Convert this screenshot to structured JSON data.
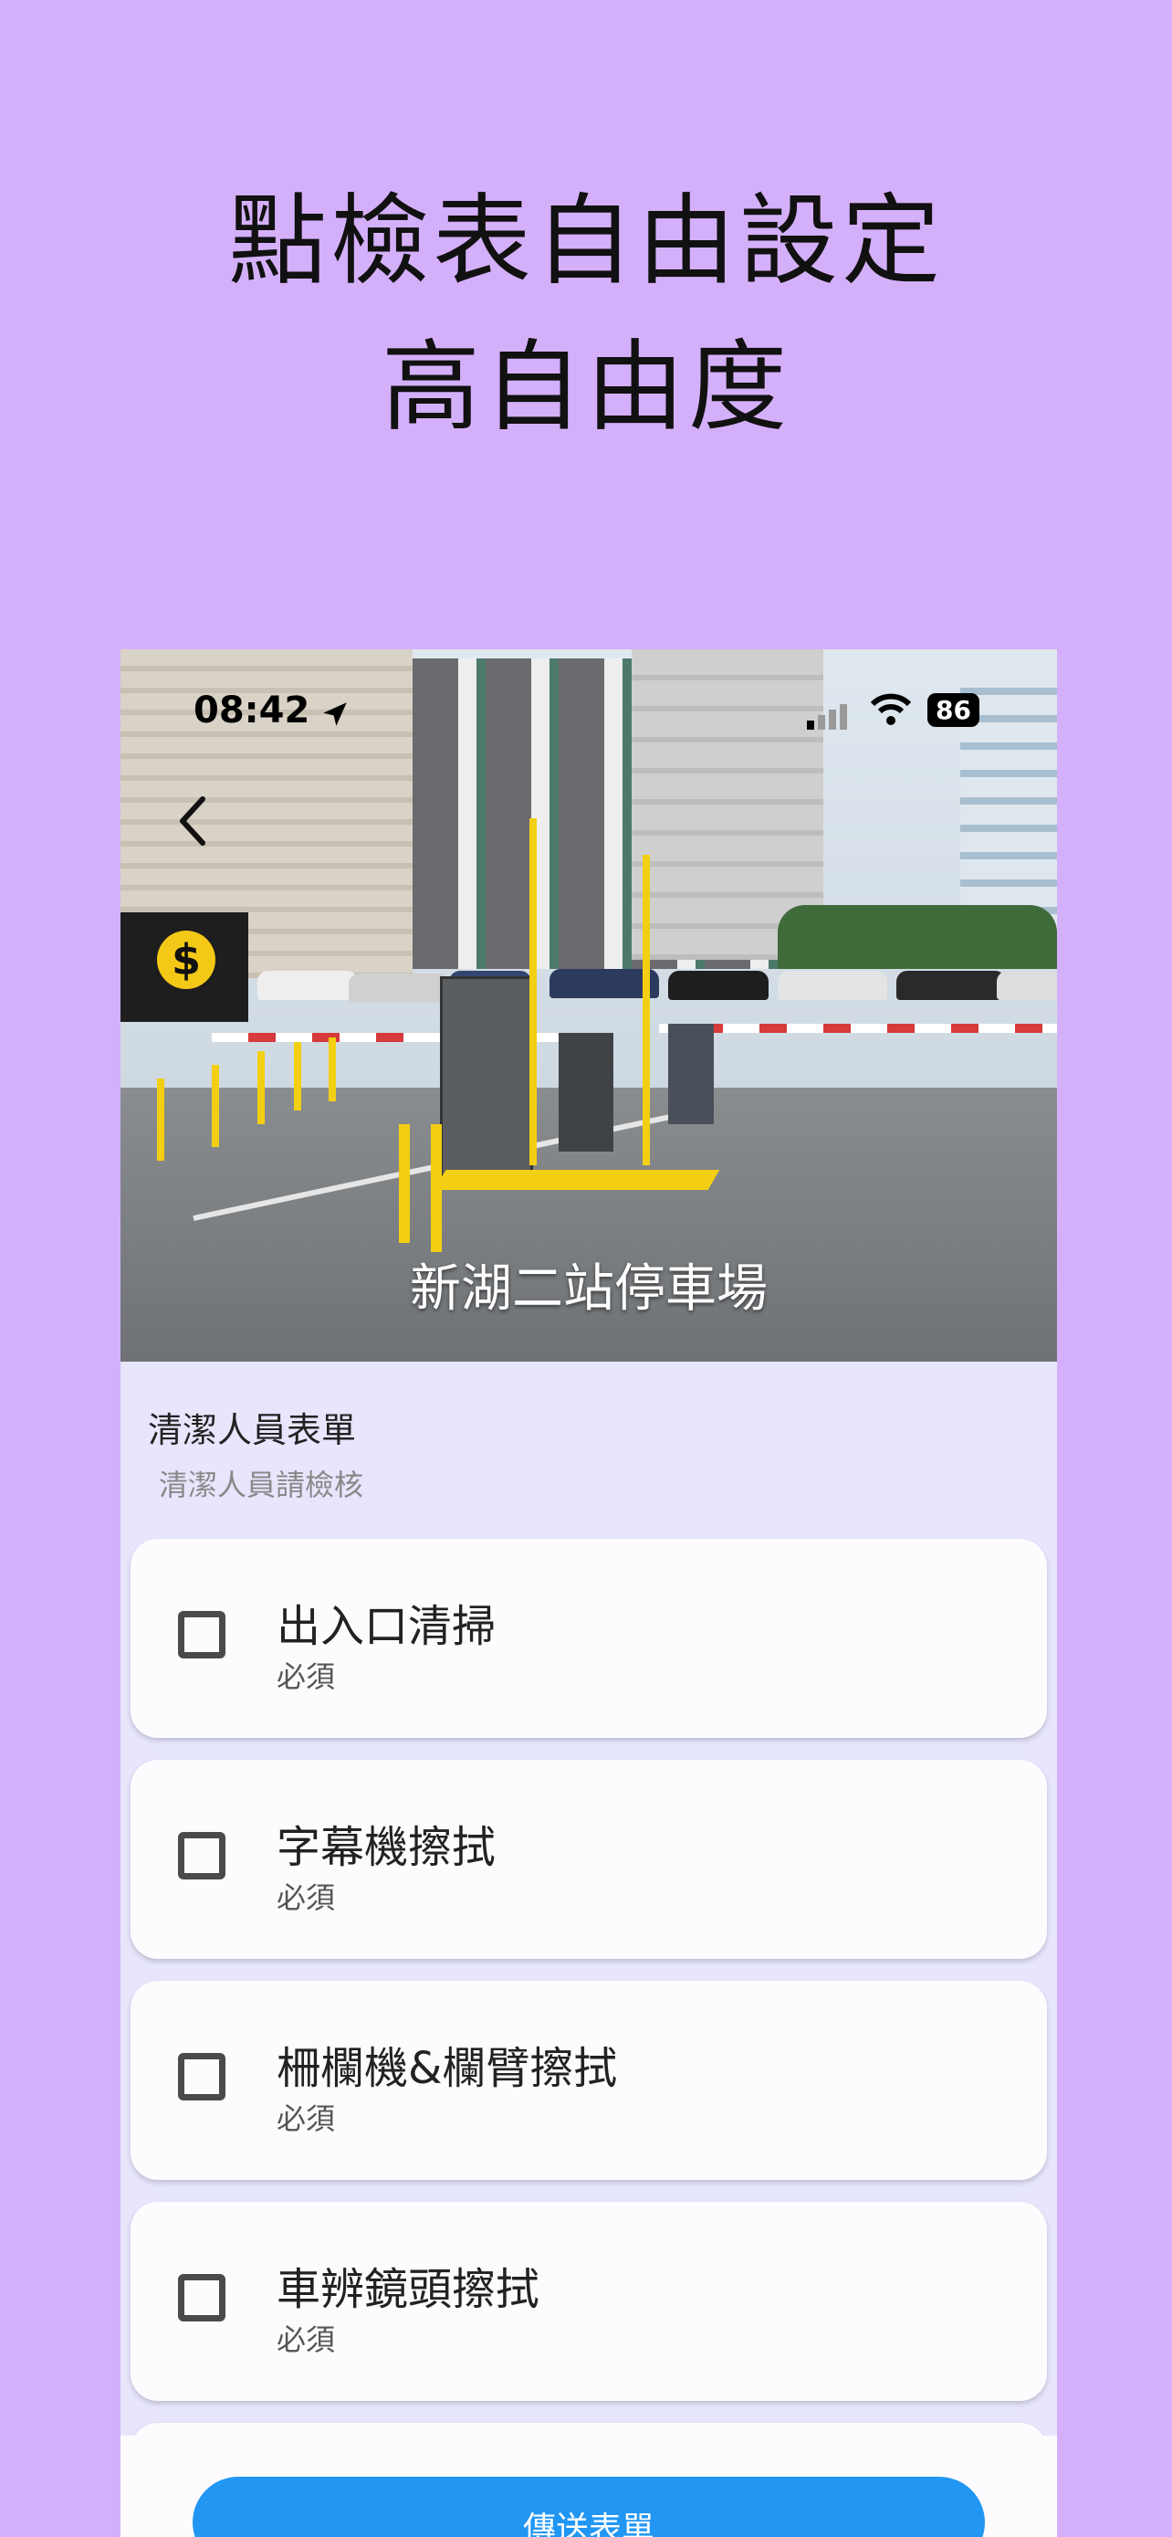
{
  "headline": {
    "line1": "點檢表自由設定",
    "line2": "高自由度"
  },
  "status_bar": {
    "time": "08:42",
    "battery": "86",
    "icons": [
      "location-arrow-icon",
      "signal-icon",
      "wifi-icon",
      "battery-icon"
    ]
  },
  "header": {
    "back_icon": "chevron-left-icon",
    "location_name": "新湖二站停車場"
  },
  "form": {
    "title": "清潔人員表單",
    "subtitle": "清潔人員請檢核",
    "items": [
      {
        "label": "出入口清掃",
        "requirement": "必須",
        "checked": false
      },
      {
        "label": "字幕機擦拭",
        "requirement": "必須",
        "checked": false
      },
      {
        "label": "柵欄機&欄臂擦拭",
        "requirement": "必須",
        "checked": false
      },
      {
        "label": "車辨鏡頭擦拭",
        "requirement": "必須",
        "checked": false
      }
    ]
  },
  "submit_button": {
    "label": "傳送表單",
    "color": "#2196f3"
  },
  "colors": {
    "page_background": "#d5b0fa",
    "form_background": "#e7e6fd",
    "card_background": "#fefbff"
  }
}
